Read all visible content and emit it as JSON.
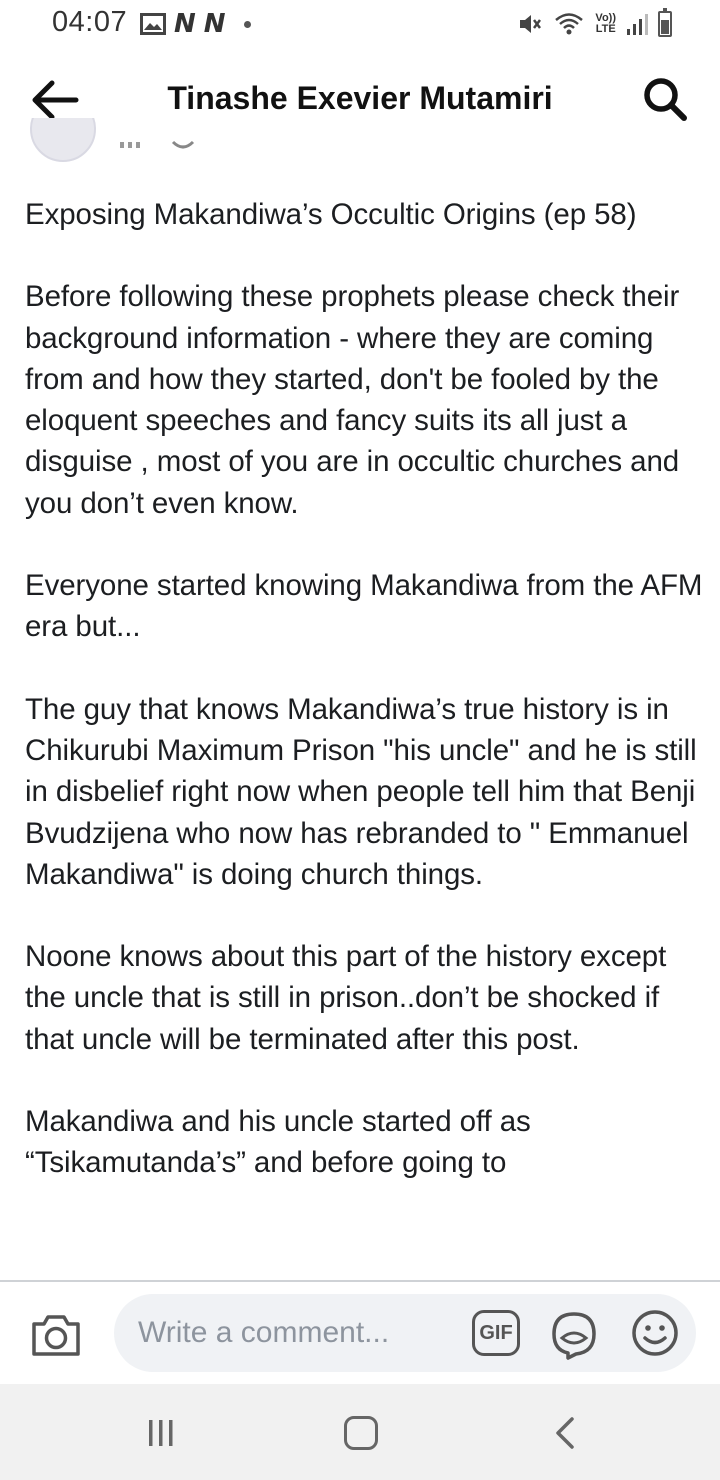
{
  "status_bar": {
    "time": "04:07",
    "left_icons": [
      "image-icon",
      "n-notification-icon",
      "n-notification-icon",
      "dot-icon"
    ],
    "right_icons": [
      "mute-icon",
      "wifi-icon",
      "volte-icon",
      "signal-icon",
      "battery-icon"
    ],
    "volte_line1": "Vo))",
    "volte_line2": "LTE",
    "n_glyph": "N"
  },
  "header": {
    "title": "Tinashe Exevier Mutamiri",
    "back_icon": "arrow-left-icon",
    "search_icon": "search-icon"
  },
  "post": {
    "paragraphs": [
      "Exposing Makandiwa’s Occultic Origins (ep 58)",
      "Before following these prophets please check their background information - where they are coming from and how they started, don't be fooled by the eloquent speeches and fancy suits its all just a disguise , most of you are in occultic churches and you don’t even know.",
      "Everyone started knowing Makandiwa from the AFM era but...",
      "The guy that knows Makandiwa’s true history is in Chikurubi Maximum Prison \"his uncle\" and he is still in disbelief right now when people tell him that Benji Bvudzijena who now has rebranded to \" Emmanuel Makandiwa\" is doing church things.",
      "Noone knows about this part of the history except the uncle that is still in prison..don’t be shocked if that uncle will be terminated after this post.",
      "Makandiwa and his uncle started off as “Tsikamutanda’s” and before going to"
    ]
  },
  "composer": {
    "placeholder": "Write a comment...",
    "gif_label": "GIF",
    "camera_icon": "camera-icon",
    "sticker_icon": "sticker-icon",
    "emoji_icon": "smiley-icon"
  },
  "nav_bar": {
    "buttons": [
      "recents-icon",
      "home-icon",
      "back-chevron-icon"
    ]
  }
}
